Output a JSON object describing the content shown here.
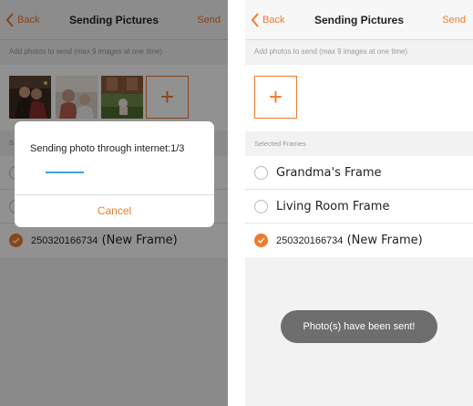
{
  "colors": {
    "accent": "#f07a2e",
    "progress": "#3aa2e3",
    "toast_bg": "#6e6e6e"
  },
  "left_screen": {
    "navbar": {
      "back_label": "Back",
      "title": "Sending Pictures",
      "send_label": "Send"
    },
    "hint": "Add photos to send (max 9 images at one time)",
    "photos": [
      {
        "name": "thumbnail-photo-1"
      },
      {
        "name": "thumbnail-photo-2"
      },
      {
        "name": "thumbnail-photo-3"
      }
    ],
    "add_photo_icon": "plus-icon",
    "section_label": "S",
    "frames": [
      {
        "name": "",
        "checked": false
      },
      {
        "name": "",
        "checked": false
      },
      {
        "id": "250320166734",
        "name": "(New Frame)",
        "checked": true
      }
    ],
    "dialog": {
      "message": "Sending photo through internet:1/3",
      "progress": 0.24,
      "cancel_label": "Cancel"
    }
  },
  "right_screen": {
    "navbar": {
      "back_label": "Back",
      "title": "Sending Pictures",
      "send_label": "Send"
    },
    "hint": "Add photos to send (max 9 images at one time)",
    "add_photo_icon": "plus-icon",
    "section_label": "Selected Frames",
    "frames": [
      {
        "name": "Grandma's Frame",
        "checked": false
      },
      {
        "name": "Living Room Frame",
        "checked": false
      },
      {
        "id": "250320166734",
        "name": "(New Frame)",
        "checked": true
      }
    ],
    "toast": "Photo(s) have been sent!"
  }
}
